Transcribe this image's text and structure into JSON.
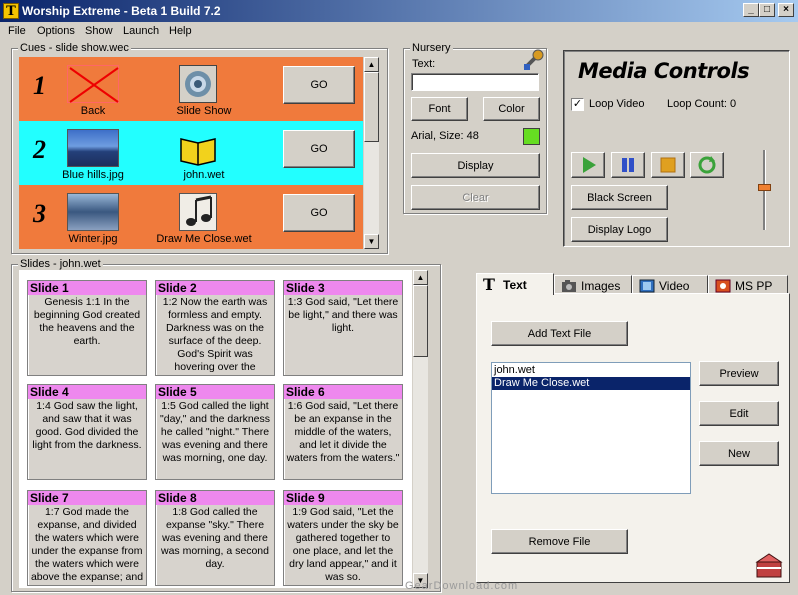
{
  "window": {
    "title": "Worship Extreme - Beta 1 Build 7.2",
    "minimize": "_",
    "maximize": "□",
    "close": "×"
  },
  "menu": [
    "File",
    "Options",
    "Show",
    "Launch",
    "Help"
  ],
  "cues": {
    "label": "Cues - slide show.wec",
    "rows": [
      {
        "number": "1",
        "left_label": "Back",
        "right_label": "Slide Show",
        "go": "GO",
        "color": "#f07a3c"
      },
      {
        "number": "2",
        "left_label": "Blue hills.jpg",
        "right_label": "john.wet",
        "go": "GO",
        "color": "#22ffff"
      },
      {
        "number": "3",
        "left_label": "Winter.jpg",
        "right_label": "Draw Me Close.wet",
        "go": "GO",
        "color": "#f07a3c"
      }
    ]
  },
  "nursery": {
    "label": "Nursery",
    "text_label": "Text:",
    "text_value": "",
    "font_button": "Font",
    "color_button": "Color",
    "font_info": "Arial, Size: 48",
    "swatch_color": "#66dd22",
    "display_button": "Display",
    "clear_button": "Clear"
  },
  "media": {
    "title": "Media Controls",
    "loop_video_label": "Loop Video",
    "loop_video_checked": true,
    "loop_count": "Loop Count: 0",
    "black_screen": "Black Screen",
    "display_logo": "Display Logo"
  },
  "slides": {
    "label": "Slides - john.wet",
    "items": [
      {
        "title": "Slide 1",
        "text": "Genesis 1:1 In the beginning God created the heavens and the earth."
      },
      {
        "title": "Slide 2",
        "text": "1:2 Now the earth was formless and empty. Darkness was on the surface of the deep. God's Spirit was hovering over the"
      },
      {
        "title": "Slide 3",
        "text": "1:3 God said, \"Let there be light,\" and there was light."
      },
      {
        "title": "Slide 4",
        "text": "1:4 God saw the light, and saw that it was good. God divided the light from the darkness."
      },
      {
        "title": "Slide 5",
        "text": "1:5 God called the light \"day,\" and the darkness he called \"night.\" There was evening and there was morning, one day."
      },
      {
        "title": "Slide 6",
        "text": "1:6 God said, \"Let there be an expanse in the middle of the waters, and let it divide the waters from the waters.\""
      },
      {
        "title": "Slide 7",
        "text": "1:7 God made the expanse, and divided the waters which were under the expanse from the waters which were above the expanse; and"
      },
      {
        "title": "Slide 8",
        "text": "1:8 God called the expanse \"sky.\" There was evening and there was morning, a second day."
      },
      {
        "title": "Slide 9",
        "text": "1:9 God said, \"Let the waters under the sky be gathered together to one place, and let the dry land appear,\" and it was so."
      }
    ]
  },
  "tabs": [
    {
      "label": "Text",
      "active": true
    },
    {
      "label": "Images",
      "active": false
    },
    {
      "label": "Video",
      "active": false
    },
    {
      "label": "MS PP",
      "active": false
    }
  ],
  "text_tab": {
    "add_button": "Add Text File",
    "files": [
      "john.wet",
      "Draw Me Close.wet"
    ],
    "selected_index": 1,
    "preview": "Preview",
    "edit": "Edit",
    "new": "New",
    "remove": "Remove File"
  },
  "watermark": "GearDownload.com"
}
